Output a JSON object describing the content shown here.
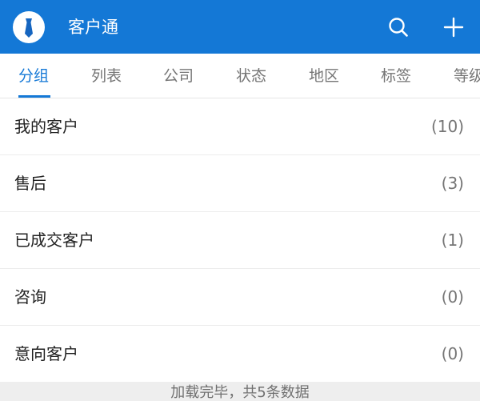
{
  "header": {
    "title": "客户通",
    "logo_icon": "necktie-icon",
    "search_icon": "search-icon",
    "add_icon": "plus-icon",
    "color": "#1478d6"
  },
  "tabs": [
    {
      "label": "分组",
      "active": true
    },
    {
      "label": "列表",
      "active": false
    },
    {
      "label": "公司",
      "active": false
    },
    {
      "label": "状态",
      "active": false
    },
    {
      "label": "地区",
      "active": false
    },
    {
      "label": "标签",
      "active": false
    },
    {
      "label": "等级",
      "active": false
    }
  ],
  "groups": [
    {
      "label": "我的客户",
      "count": "(10)"
    },
    {
      "label": "售后",
      "count": "(3)"
    },
    {
      "label": "已成交客户",
      "count": "(1)"
    },
    {
      "label": "咨询",
      "count": "(0)"
    },
    {
      "label": "意向客户",
      "count": "(0)"
    }
  ],
  "footer": {
    "text": "加载完毕，共5条数据"
  }
}
